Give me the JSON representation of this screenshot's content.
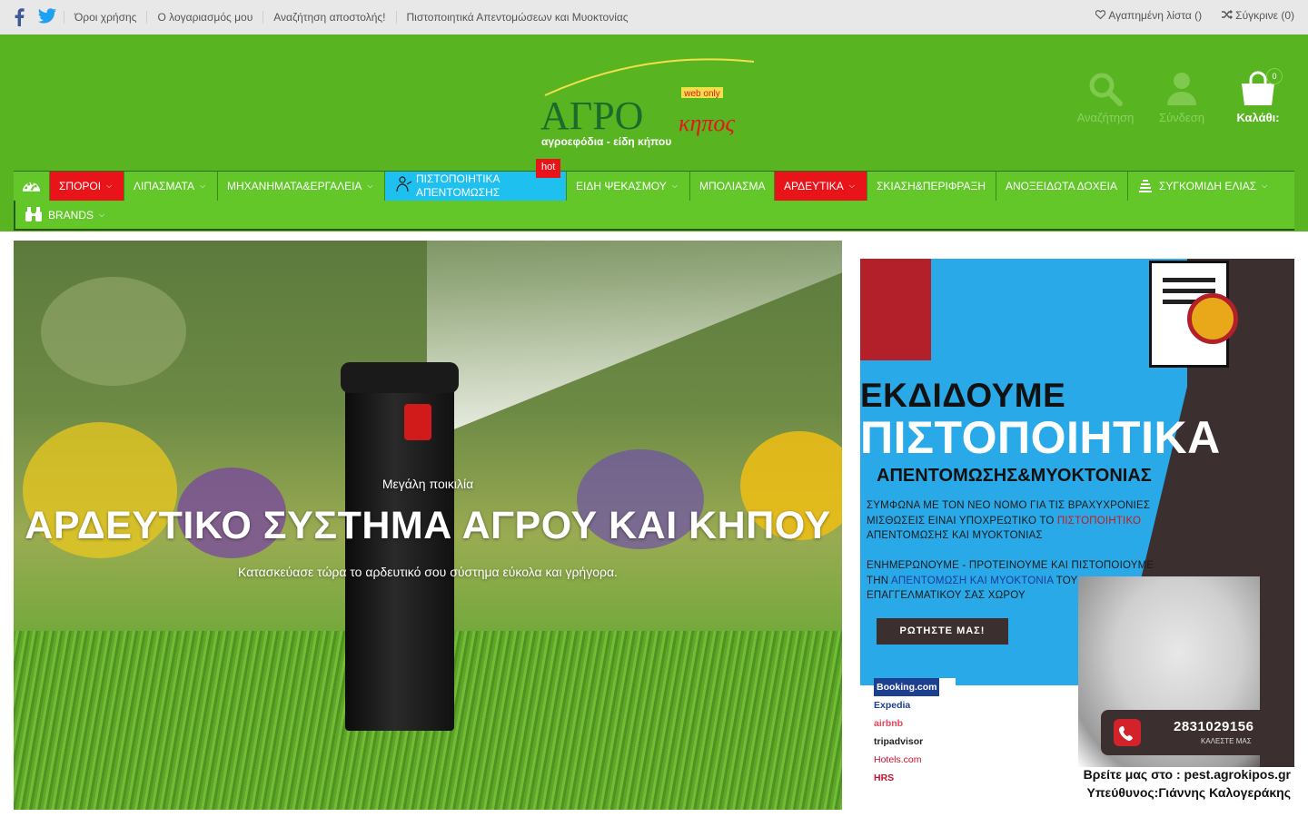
{
  "topbar": {
    "links": [
      "Όροι χρήσης",
      "Ο λογαριασμός μου",
      "Αναζήτηση αποστολής!",
      "Πιστοποιητικά Απεντομώσεων και Μυοκτονίας"
    ],
    "wishlist": "Αγαπημένη λίστα ()",
    "compare": "Σύγκρινε (0)"
  },
  "logo": {
    "main": "ΑΓΡΟ",
    "script": "κηπος",
    "tag": "web only",
    "tagline": "αγροεφόδια - είδη κήπου"
  },
  "header_icons": {
    "search": "Αναζήτηση",
    "login": "Σύνδεση",
    "cart": "Καλάθι:",
    "cart_count": "0"
  },
  "nav": {
    "items": [
      "ΣΠΟΡΟΙ",
      "ΛΙΠΑΣΜΑΤΑ",
      "ΜΗΧΑΝΗΜΑΤΑ&ΕΡΓΑΛΕΙΑ",
      "ΠΙΣΤΟΠΟΙΗΤΙΚΑ ΑΠΕΝΤΟΜΩΣΗΣ",
      "ΕΙΔΗ ΨΕΚΑΣΜΟΥ",
      "ΜΠΟΛΙΑΣΜΑ",
      "ΑΡΔΕΥΤΙΚΑ",
      "ΣΚΙΑΣΗ&ΠΕΡΙΦΡΑΞΗ",
      "ΑΝΟΞΕΙΔΩΤΑ ΔΟΧΕΙΑ",
      "ΣΥΓΚΟΜΙΔΗ ΕΛΙΑΣ",
      "BRANDS"
    ],
    "hot_label": "hot"
  },
  "hero": {
    "sub": "Μεγάλη ποικιλία",
    "title": "ΑΡΔΕΥΤΙΚΟ ΣΥΣΤΗΜΑ ΑΓΡΟΥ ΚΑΙ ΚΗΠΟΥ",
    "desc": "Κατασκεύασε τώρα το αρδευτικό σου σύστημα εύκολα και γρήγορα."
  },
  "promo": {
    "h1": "ΕΚΔΙΔΟΥΜΕ",
    "h2": "ΠΙΣΤΟΠΟΙΗΤΙΚΑ",
    "h3": "ΑΠΕΝΤΟΜΩΣΗΣ&ΜΥΟΚΤΟΝΙΑΣ",
    "p1_a": "ΣΥΜΦΩΝΑ ΜΕ ΤΟΝ ΝΕΟ ΝΟΜΟ ΓΙΑ ΤΙΣ ΒΡΑΧΥΧΡΟΝΙΕΣ ΜΙΣΘΩΣΕΙΣ ΕΙΝΑΙ ΥΠΟΧΡΕΩΤΙΚΟ ΤΟ",
    "p1_red": "ΠΙΣΤΟΠΟΙΗΤΙΚΟ",
    "p1_b": "ΑΠΕΝΤΟΜΩΣΗΣ ΚΑΙ ΜΥΟΚΤΟΝΙΑΣ",
    "p2_a": "ΕΝΗΜΕΡΩΝΟΥΜΕ - ΠΡΟΤΕΙΝΟΥΜΕ ΚΑΙ ΠΙΣΤΟΠΟΙΟΥΜΕ ΤΗΝ",
    "p2_hl": "ΑΠΕΝΤΟΜΩΣΗ ΚΑΙ ΜΥΟΚΤΟΝΙΑ",
    "p2_b": "ΤΟΥ ΕΠΑΓΓΕΛΜΑΤΙΚΟΥ ΣΑΣ ΧΩΡΟΥ",
    "ask": "ΡΩΤΗΣΤΕ ΜΑΣ!",
    "brands": [
      "Booking.com",
      "Expedia",
      "airbnb",
      "tripadvisor",
      "Hotels.com",
      "HRS"
    ],
    "phone": "2831029156",
    "phone_label": "ΚΑΛΕΣΤΕ ΜΑΣ",
    "footer1": "Βρείτε μας στο : pest.agrokipos.gr",
    "footer2": "Υπεύθυνος:Γιάννης Καλογεράκης"
  },
  "colors": {
    "header_green": "#58b421",
    "nav_green": "#63c72a",
    "nav_red": "#e8141a",
    "nav_cyan": "#1ec0f0",
    "topbar_grey": "#e8e8e8"
  }
}
